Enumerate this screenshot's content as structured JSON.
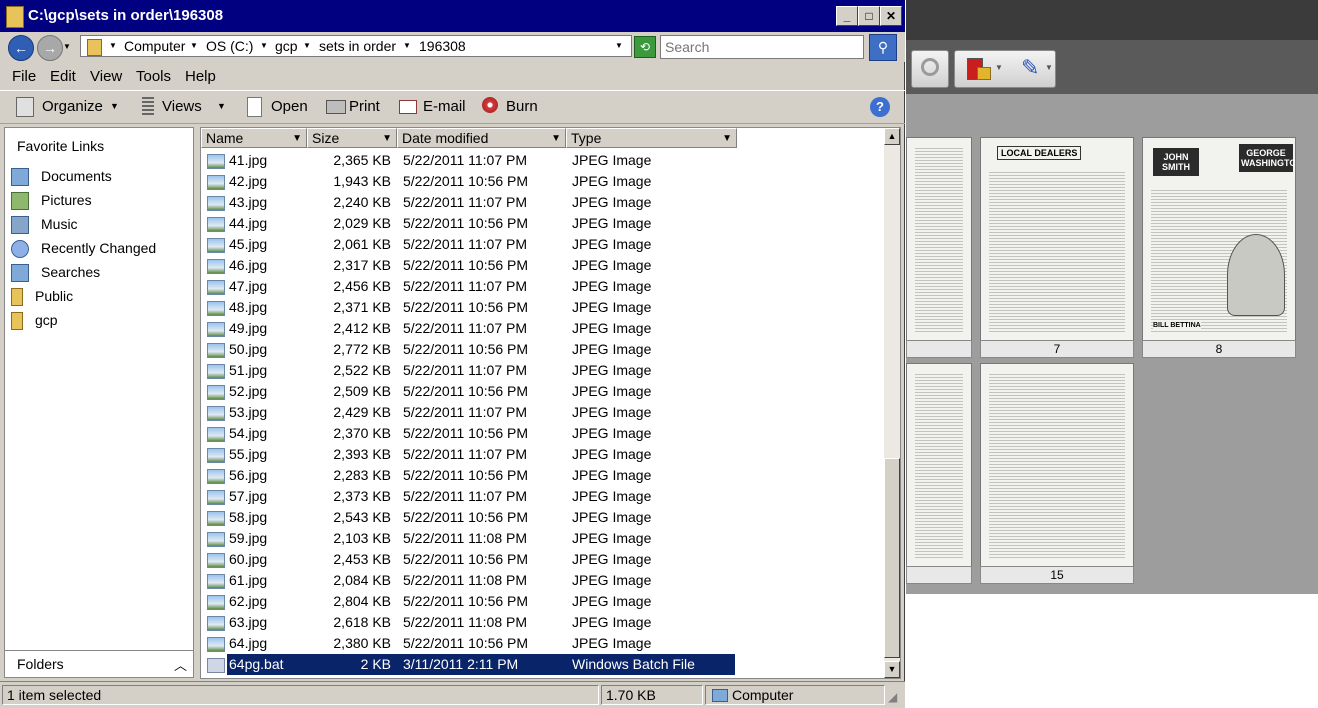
{
  "window": {
    "title": "C:\\gcp\\sets in order\\196308"
  },
  "address": {
    "crumbs": [
      "Computer",
      "OS (C:)",
      "gcp",
      "sets in order",
      "196308"
    ]
  },
  "search": {
    "placeholder": "Search"
  },
  "menu": [
    "File",
    "Edit",
    "View",
    "Tools",
    "Help"
  ],
  "commands": {
    "organize": "Organize",
    "views": "Views",
    "open": "Open",
    "print": "Print",
    "email": "E-mail",
    "burn": "Burn"
  },
  "nav": {
    "title": "Favorite Links",
    "links": [
      "Documents",
      "Pictures",
      "Music",
      "Recently Changed",
      "Searches",
      "Public",
      "gcp"
    ],
    "folders_label": "Folders"
  },
  "columns": [
    "Name",
    "Size",
    "Date modified",
    "Type"
  ],
  "files": [
    {
      "name": "41.jpg",
      "size": "2,365 KB",
      "date": "5/22/2011 11:07 PM",
      "type": "JPEG Image"
    },
    {
      "name": "42.jpg",
      "size": "1,943 KB",
      "date": "5/22/2011 10:56 PM",
      "type": "JPEG Image"
    },
    {
      "name": "43.jpg",
      "size": "2,240 KB",
      "date": "5/22/2011 11:07 PM",
      "type": "JPEG Image"
    },
    {
      "name": "44.jpg",
      "size": "2,029 KB",
      "date": "5/22/2011 10:56 PM",
      "type": "JPEG Image"
    },
    {
      "name": "45.jpg",
      "size": "2,061 KB",
      "date": "5/22/2011 11:07 PM",
      "type": "JPEG Image"
    },
    {
      "name": "46.jpg",
      "size": "2,317 KB",
      "date": "5/22/2011 10:56 PM",
      "type": "JPEG Image"
    },
    {
      "name": "47.jpg",
      "size": "2,456 KB",
      "date": "5/22/2011 11:07 PM",
      "type": "JPEG Image"
    },
    {
      "name": "48.jpg",
      "size": "2,371 KB",
      "date": "5/22/2011 10:56 PM",
      "type": "JPEG Image"
    },
    {
      "name": "49.jpg",
      "size": "2,412 KB",
      "date": "5/22/2011 11:07 PM",
      "type": "JPEG Image"
    },
    {
      "name": "50.jpg",
      "size": "2,772 KB",
      "date": "5/22/2011 10:56 PM",
      "type": "JPEG Image"
    },
    {
      "name": "51.jpg",
      "size": "2,522 KB",
      "date": "5/22/2011 11:07 PM",
      "type": "JPEG Image"
    },
    {
      "name": "52.jpg",
      "size": "2,509 KB",
      "date": "5/22/2011 10:56 PM",
      "type": "JPEG Image"
    },
    {
      "name": "53.jpg",
      "size": "2,429 KB",
      "date": "5/22/2011 11:07 PM",
      "type": "JPEG Image"
    },
    {
      "name": "54.jpg",
      "size": "2,370 KB",
      "date": "5/22/2011 10:56 PM",
      "type": "JPEG Image"
    },
    {
      "name": "55.jpg",
      "size": "2,393 KB",
      "date": "5/22/2011 11:07 PM",
      "type": "JPEG Image"
    },
    {
      "name": "56.jpg",
      "size": "2,283 KB",
      "date": "5/22/2011 10:56 PM",
      "type": "JPEG Image"
    },
    {
      "name": "57.jpg",
      "size": "2,373 KB",
      "date": "5/22/2011 11:07 PM",
      "type": "JPEG Image"
    },
    {
      "name": "58.jpg",
      "size": "2,543 KB",
      "date": "5/22/2011 10:56 PM",
      "type": "JPEG Image"
    },
    {
      "name": "59.jpg",
      "size": "2,103 KB",
      "date": "5/22/2011 11:08 PM",
      "type": "JPEG Image"
    },
    {
      "name": "60.jpg",
      "size": "2,453 KB",
      "date": "5/22/2011 10:56 PM",
      "type": "JPEG Image"
    },
    {
      "name": "61.jpg",
      "size": "2,084 KB",
      "date": "5/22/2011 11:08 PM",
      "type": "JPEG Image"
    },
    {
      "name": "62.jpg",
      "size": "2,804 KB",
      "date": "5/22/2011 10:56 PM",
      "type": "JPEG Image"
    },
    {
      "name": "63.jpg",
      "size": "2,618 KB",
      "date": "5/22/2011 11:08 PM",
      "type": "JPEG Image"
    },
    {
      "name": "64.jpg",
      "size": "2,380 KB",
      "date": "5/22/2011 10:56 PM",
      "type": "JPEG Image"
    },
    {
      "name": "64pg.bat",
      "size": "2 KB",
      "date": "3/11/2011 2:11 PM",
      "type": "Windows Batch File",
      "selected": true
    }
  ],
  "status": {
    "selection": "1 item selected",
    "size": "1.70 KB",
    "location": "Computer"
  },
  "viewer": {
    "page_labels": [
      "7",
      "8",
      "15"
    ],
    "page_text": {
      "dealers_title": "LOCAL DEALERS",
      "badge_left": "JOHN SMITH",
      "badge_right": "GEORGE WASHINGTON",
      "caption": "BILL BETTINA"
    }
  }
}
